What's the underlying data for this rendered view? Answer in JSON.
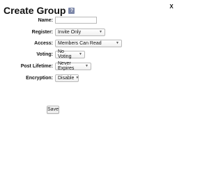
{
  "dialog": {
    "title": "Create Group",
    "help_icon": "?",
    "close_label": "X"
  },
  "form": {
    "name": {
      "label": "Name:",
      "value": ""
    },
    "register": {
      "label": "Register:",
      "value": "Invite Only"
    },
    "access": {
      "label": "Access:",
      "value": "Members Can Read"
    },
    "voting": {
      "label": "Voting:",
      "value": "No Voting"
    },
    "post_lifetime": {
      "label": "Post Lifetime:",
      "value": "Never Expires"
    },
    "encryption": {
      "label": "Encryption:",
      "value": "Disable"
    }
  },
  "actions": {
    "save_label": "Save"
  },
  "icons": {
    "help": "question-mark-icon",
    "dropdown": "chevron-down-icon"
  }
}
